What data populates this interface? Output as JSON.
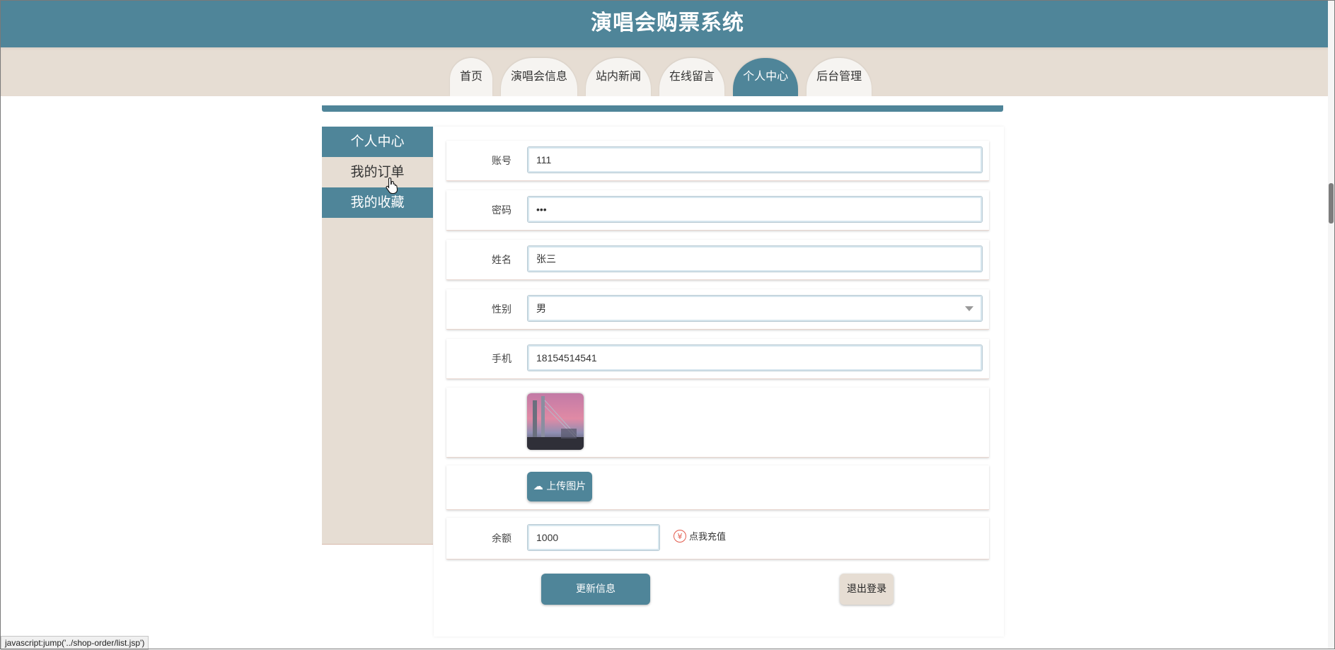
{
  "header": {
    "title": "演唱会购票系统"
  },
  "nav": {
    "tabs": [
      {
        "label": "首页",
        "active": false
      },
      {
        "label": "演唱会信息",
        "active": false
      },
      {
        "label": "站内新闻",
        "active": false
      },
      {
        "label": "在线留言",
        "active": false
      },
      {
        "label": "个人中心",
        "active": true
      },
      {
        "label": "后台管理",
        "active": false
      }
    ]
  },
  "sidebar": {
    "items": [
      {
        "label": "个人中心"
      },
      {
        "label": "我的订单"
      },
      {
        "label": "我的收藏"
      }
    ]
  },
  "form": {
    "account": {
      "label": "账号",
      "value": "111"
    },
    "password": {
      "label": "密码",
      "value": "•••"
    },
    "name": {
      "label": "姓名",
      "value": "张三"
    },
    "gender": {
      "label": "性别",
      "value": "男"
    },
    "phone": {
      "label": "手机",
      "value": "18154514541"
    },
    "upload_label": "上传图片",
    "balance": {
      "label": "余额",
      "value": "1000"
    },
    "recharge_label": "点我充值",
    "recharge_icon": "¥"
  },
  "actions": {
    "update": "更新信息",
    "logout": "退出登录"
  },
  "statusbar": {
    "text": "javascript:jump('../shop-order/list.jsp')"
  },
  "colors": {
    "primary": "#4f8599",
    "beige": "#e6ddd3",
    "recharge": "#e2584a"
  }
}
